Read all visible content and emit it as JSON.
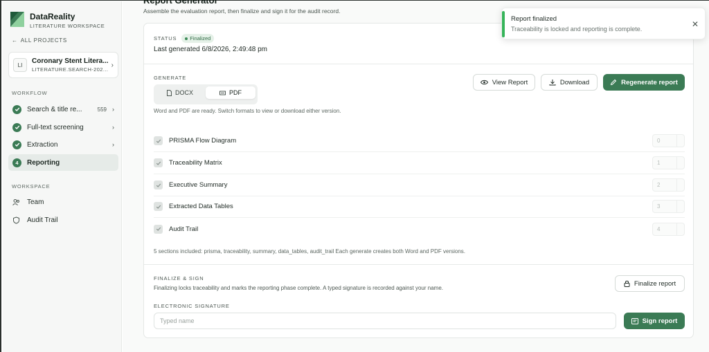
{
  "app": {
    "name": "DataReality",
    "subtitle": "LITERATURE WORKSPACE"
  },
  "sidebar": {
    "back_link": "ALL PROJECTS",
    "project": {
      "badge": "LI",
      "title": "Coronary Stent Litera...",
      "subtitle": "LITERATURE.SEARCH-202..."
    },
    "workflow_label": "WORKFLOW",
    "workflow": [
      {
        "label": "Search & title re...",
        "count": "559",
        "state": "done"
      },
      {
        "label": "Full-text screening",
        "count": "",
        "state": "done"
      },
      {
        "label": "Extraction",
        "count": "",
        "state": "done"
      },
      {
        "label": "Reporting",
        "step": "4",
        "state": "active"
      }
    ],
    "workspace_label": "WORKSPACE",
    "workspace": [
      {
        "label": "Team",
        "icon": "team-icon"
      },
      {
        "label": "Audit Trail",
        "icon": "shield-icon"
      }
    ]
  },
  "main": {
    "title": "Report Generator",
    "subtitle": "Assemble the evaluation report, then finalize and sign it for the audit record.",
    "status_label": "STATUS",
    "status_value": "Finalized",
    "last_generated": "Last generated 6/8/2026, 2:49:48 pm",
    "generate_label": "GENERATE",
    "formats": [
      "DOCX",
      "PDF"
    ],
    "selected_format": "PDF",
    "format_helper": "Word and PDF are ready. Switch formats to view or download either version.",
    "buttons": {
      "view": "View Report",
      "download": "Download",
      "regenerate": "Regenerate report"
    },
    "sections": [
      {
        "name": "PRISMA Flow Diagram",
        "order": "0",
        "checked": true
      },
      {
        "name": "Traceability Matrix",
        "order": "1",
        "checked": true
      },
      {
        "name": "Executive Summary",
        "order": "2",
        "checked": true
      },
      {
        "name": "Extracted Data Tables",
        "order": "3",
        "checked": true
      },
      {
        "name": "Audit Trail",
        "order": "4",
        "checked": true
      }
    ],
    "sections_helper": "5 sections included: prisma, traceability, summary, data_tables, audit_trail Each generate creates both Word and PDF versions.",
    "finalize_label": "FINALIZE & SIGN",
    "finalize_helper": "Finalizing locks traceability and marks the reporting phase complete. A typed signature is recorded against your name.",
    "finalize_button": "Finalize report",
    "signature_label": "ELECTRONIC SIGNATURE",
    "signature_placeholder": "Typed name",
    "sign_button": "Sign report"
  },
  "toast": {
    "title": "Report finalized",
    "message": "Traceability is locked and reporting is complete.",
    "color": "#36b45a"
  },
  "colors": {
    "accent": "#3b7b55",
    "sidebar_bg": "#f6f7f6"
  }
}
